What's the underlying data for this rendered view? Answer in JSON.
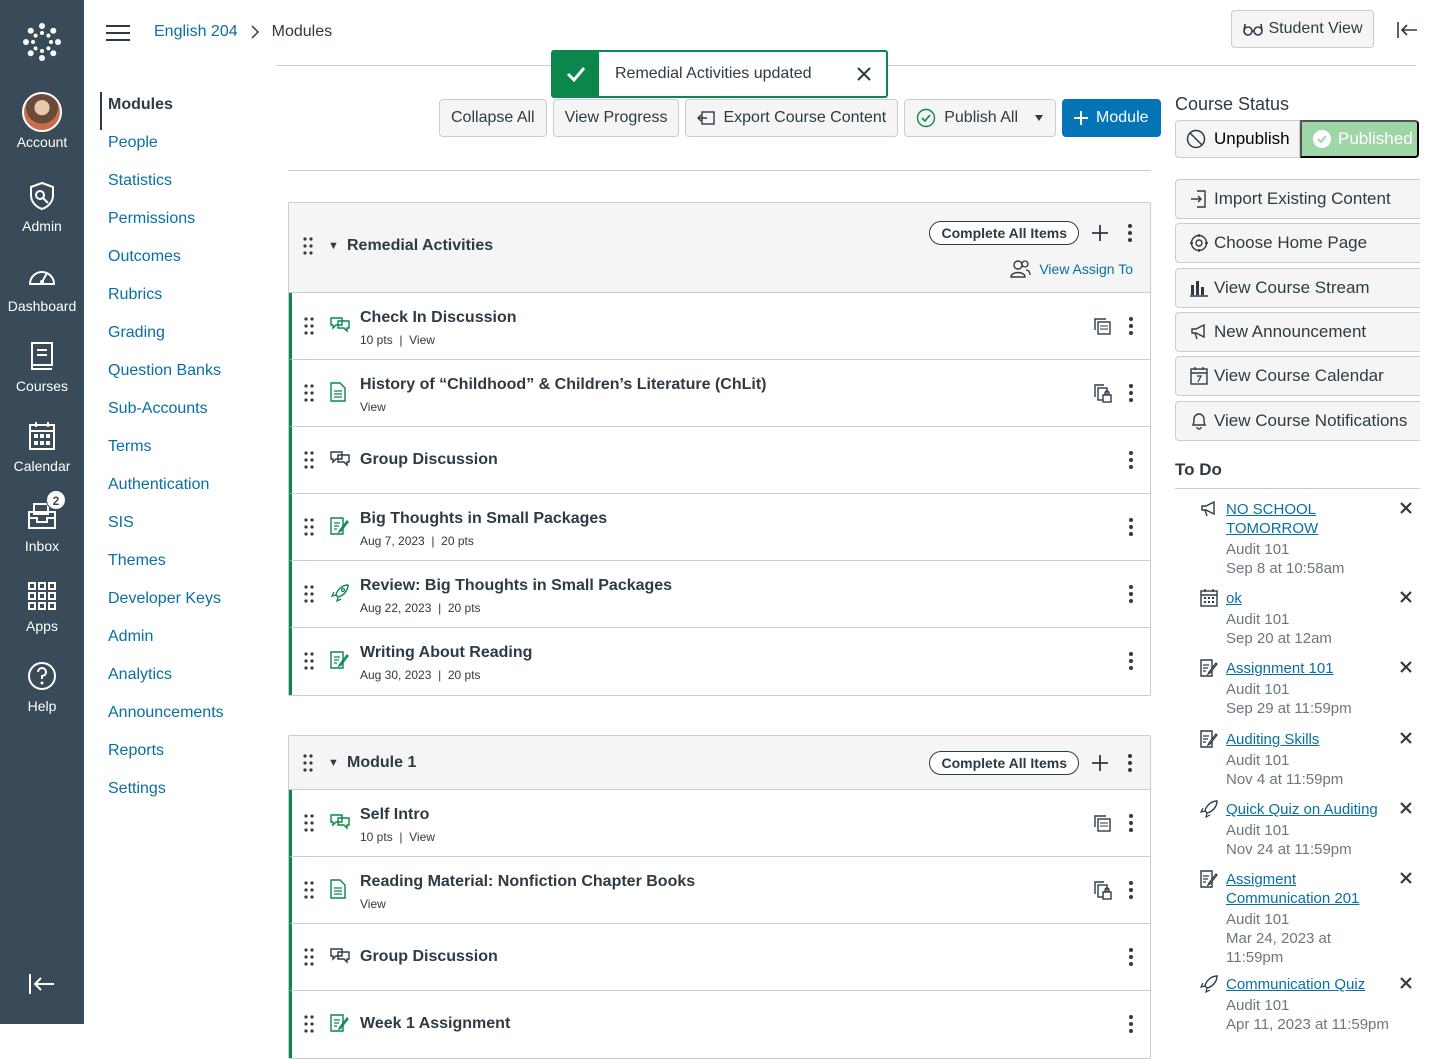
{
  "global_nav": {
    "account": "Account",
    "admin": "Admin",
    "dashboard": "Dashboard",
    "courses": "Courses",
    "calendar": "Calendar",
    "inbox": "Inbox",
    "inbox_badge": "2",
    "apps": "Apps",
    "help": "Help"
  },
  "breadcrumb": {
    "course": "English 204",
    "page": "Modules"
  },
  "student_view": "Student View",
  "toast": {
    "message": "Remedial Activities updated"
  },
  "course_nav": [
    "Modules",
    "People",
    "Statistics",
    "Permissions",
    "Outcomes",
    "Rubrics",
    "Grading",
    "Question Banks",
    "Sub-Accounts",
    "Terms",
    "Authentication",
    "SIS",
    "Themes",
    "Developer Keys",
    "Admin",
    "Analytics",
    "Announcements",
    "Reports",
    "Settings"
  ],
  "toolbar": {
    "collapse_all": "Collapse All",
    "view_progress": "View Progress",
    "export": "Export Course Content",
    "publish_all": "Publish All",
    "module": "Module"
  },
  "modules": [
    {
      "title": "Remedial Activities",
      "complete_all": "Complete All Items",
      "assign_to": "View Assign To",
      "items": [
        {
          "name": "Check In Discussion",
          "meta": "10 pts  |  View"
        },
        {
          "name": "History of “Childhood” & Children’s Literature (ChLit)",
          "meta": "View"
        },
        {
          "name": "Group Discussion",
          "meta": ""
        },
        {
          "name": "Big Thoughts in Small Packages",
          "meta": "Aug 7, 2023  |  20 pts"
        },
        {
          "name": "Review: Big Thoughts in Small Packages",
          "meta": "Aug 22, 2023  |  20 pts"
        },
        {
          "name": "Writing About Reading",
          "meta": "Aug 30, 2023  |  20 pts"
        }
      ]
    },
    {
      "title": "Module 1",
      "complete_all": "Complete All Items",
      "items": [
        {
          "name": "Self Intro",
          "meta": "10 pts  |  View"
        },
        {
          "name": "Reading Material: Nonfiction Chapter Books",
          "meta": "View"
        },
        {
          "name": "Group Discussion",
          "meta": ""
        },
        {
          "name": "Week 1 Assignment",
          "meta": ""
        }
      ]
    }
  ],
  "course_status": {
    "title": "Course Status",
    "unpublish": "Unpublish",
    "published": "Published"
  },
  "sidebar_buttons": [
    "Import Existing Content",
    "Choose Home Page",
    "View Course Stream",
    "New Announcement",
    "View Course Calendar",
    "View Course Notifications"
  ],
  "todo": {
    "title": "To Do",
    "items": [
      {
        "title": "NO SCHOOL TOMORROW",
        "course": "Audit 101",
        "due": "Sep 8 at 10:58am",
        "icon": "announcement-icon"
      },
      {
        "title": "ok",
        "course": "Audit 101",
        "due": "Sep 20 at 12am",
        "icon": "calendar-icon"
      },
      {
        "title": "Assignment 101",
        "course": "Audit 101",
        "due": "Sep 29 at 11:59pm",
        "icon": "assignment-icon"
      },
      {
        "title": "Auditing Skills",
        "course": "Audit 101",
        "due": "Nov 4 at 11:59pm",
        "icon": "assignment-icon"
      },
      {
        "title": "Quick Quiz on Auditing",
        "course": "Audit 101",
        "due": "Nov 24 at 11:59pm",
        "icon": "quiz-icon"
      },
      {
        "title": "Assigment Communication 201",
        "course": "Audit 101",
        "due": "Mar 24, 2023 at 11:59pm",
        "icon": "assignment-icon"
      },
      {
        "title": "Communication Quiz",
        "course": "Audit 101",
        "due": "Apr 11, 2023 at 11:59pm",
        "icon": "quiz-icon"
      }
    ]
  },
  "colors": {
    "nav_bg": "#394b58",
    "link": "#0770a3",
    "success": "#0b874b",
    "primary": "#0374b5"
  }
}
